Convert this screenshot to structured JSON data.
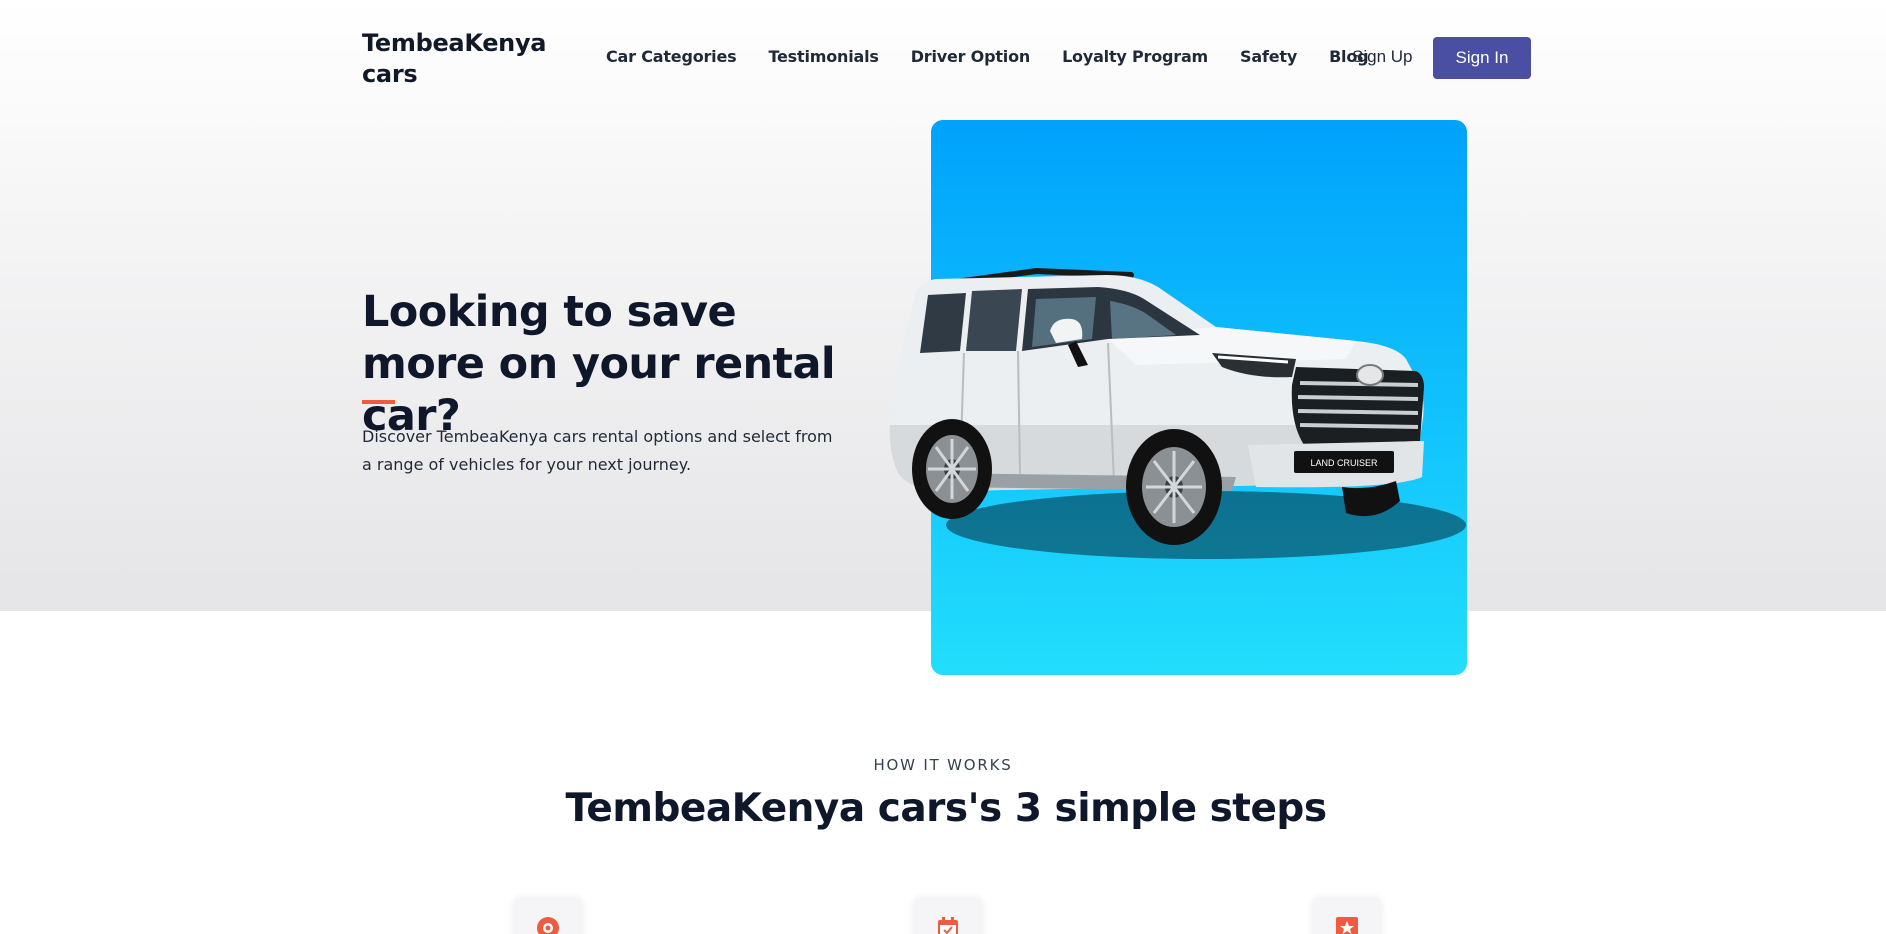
{
  "brand": {
    "name": "TembeaKenya cars"
  },
  "nav": {
    "links": [
      "Car Categories",
      "Testimonials",
      "Driver Option",
      "Loyalty Program",
      "Safety",
      "Blog"
    ],
    "signup_label": "Sign Up",
    "signin_label": "Sign In"
  },
  "hero": {
    "title": "Looking to save more on your rental car?",
    "description": "Discover TembeaKenya cars rental options and select from a range of vehicles for your next journey.",
    "car_plate_text": "LAND CRUISER"
  },
  "how": {
    "eyebrow": "HOW IT WORKS",
    "title": "TembeaKenya cars's 3 simple steps",
    "steps": [
      {
        "icon": "location-pin-icon"
      },
      {
        "icon": "calendar-check-icon"
      },
      {
        "icon": "star-badge-icon"
      }
    ]
  },
  "colors": {
    "accent": "#ef5b40",
    "signin_button": "#4b4fa3",
    "hero_panel_top": "#00a2fb",
    "hero_panel_bottom": "#22defc"
  }
}
